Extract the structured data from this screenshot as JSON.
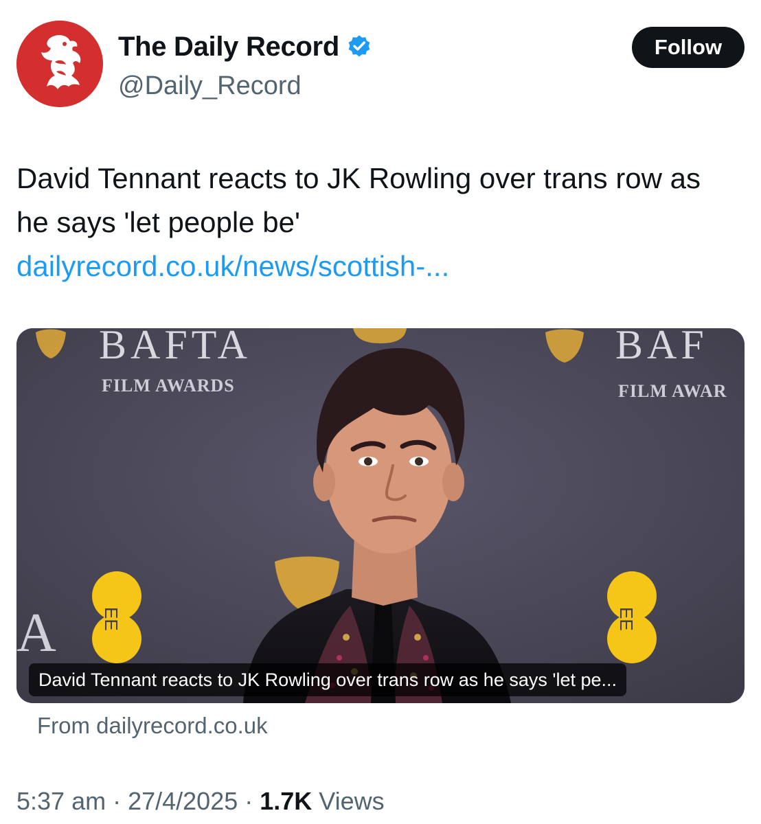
{
  "account": {
    "display_name": "The Daily Record",
    "handle": "@Daily_Record",
    "verified": true,
    "avatar_icon": "lion-rampant-logo",
    "avatar_color": "#d32f2f"
  },
  "follow_label": "Follow",
  "tweet": {
    "text": "David Tennant reacts to JK Rowling over trans row as he says 'let people be' ",
    "link_text": "dailyrecord.co.uk/news/scottish-..."
  },
  "card": {
    "caption": "David Tennant reacts to JK Rowling over trans row as he says 'let pe...",
    "source": "From dailyrecord.co.uk",
    "backdrop_left_title": "BAFTA",
    "backdrop_left_subtitle": "FILM AWARDS",
    "backdrop_right_title": "BAF",
    "backdrop_right_subtitle": "FILM AWAR",
    "backdrop_left_edge_letter": "A",
    "sponsor_logo_text": "EE"
  },
  "meta": {
    "time": "5:37 am",
    "separator": " · ",
    "date": "27/4/2025",
    "views_count": "1.7K",
    "views_label": " Views"
  },
  "colors": {
    "link": "#1d9bf0",
    "secondary_text": "#536471",
    "primary_text": "#0f1419",
    "verified_badge": "#1d9bf0",
    "backdrop": "#4d4a55",
    "gold": "#d8a43a",
    "ee_yellow": "#f5c518"
  }
}
